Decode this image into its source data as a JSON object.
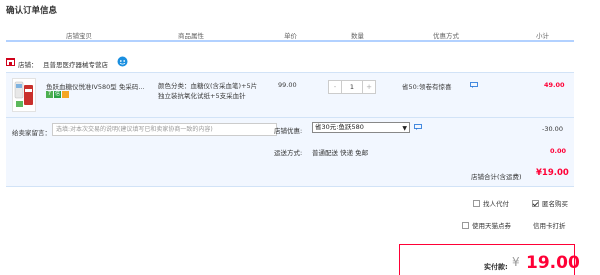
{
  "page": {
    "title": "确认订单信息"
  },
  "columns": [
    "店铺宝贝",
    "商品属性",
    "单价",
    "数量",
    "优惠方式",
    "小计"
  ],
  "shop": {
    "label": "店铺：",
    "name": "且普思医疗器械专营店"
  },
  "item": {
    "title": "鱼跃血糖仪悦准IV580型 免采码...",
    "attributes": "颜色分类：血糖仪(含采血笔)+5片独立装抗氧化试纸+5支采血针",
    "price": "99.00",
    "quantity": "1",
    "qty_minus": "-",
    "qty_plus": "+",
    "promo": "省50:领卷有惊喜",
    "subtotal": "49.00",
    "badges": [
      {
        "text": "7",
        "color": "#4caf50"
      },
      {
        "text": "信",
        "color": "#2ba245"
      },
      {
        "text": "",
        "color": "#f5a623"
      }
    ]
  },
  "options": {
    "message_label": "给卖家留言：",
    "message_placeholder": "选填:对本次交易的说明(建议填写已和卖家协商一致的内容)",
    "shop_promo_label": "店铺优惠:",
    "shop_promo_value": "省30元:鱼跃580",
    "shop_promo_discount": "-30.00",
    "shipping_label": "运送方式:",
    "shipping_method": "普通配送 快递 免邮",
    "shipping_cost": "0.00",
    "shop_total_label": "店铺合计(含运费)",
    "shop_total_value": "¥19.00"
  },
  "checkout": {
    "proxy_pay_label": "找人代付",
    "anonymous_label": "匿名购买",
    "tmall_points_label": "使用天猫点券",
    "installment_label": "信用卡打折",
    "total_label": "实付款:",
    "total_currency": "¥",
    "total_amount": "19.00"
  },
  "colors": {
    "accent": "#ff0036",
    "row_bg": "#f2f7ff",
    "header_line": "#b2d1ff",
    "link_blue": "#1a6ed8"
  }
}
